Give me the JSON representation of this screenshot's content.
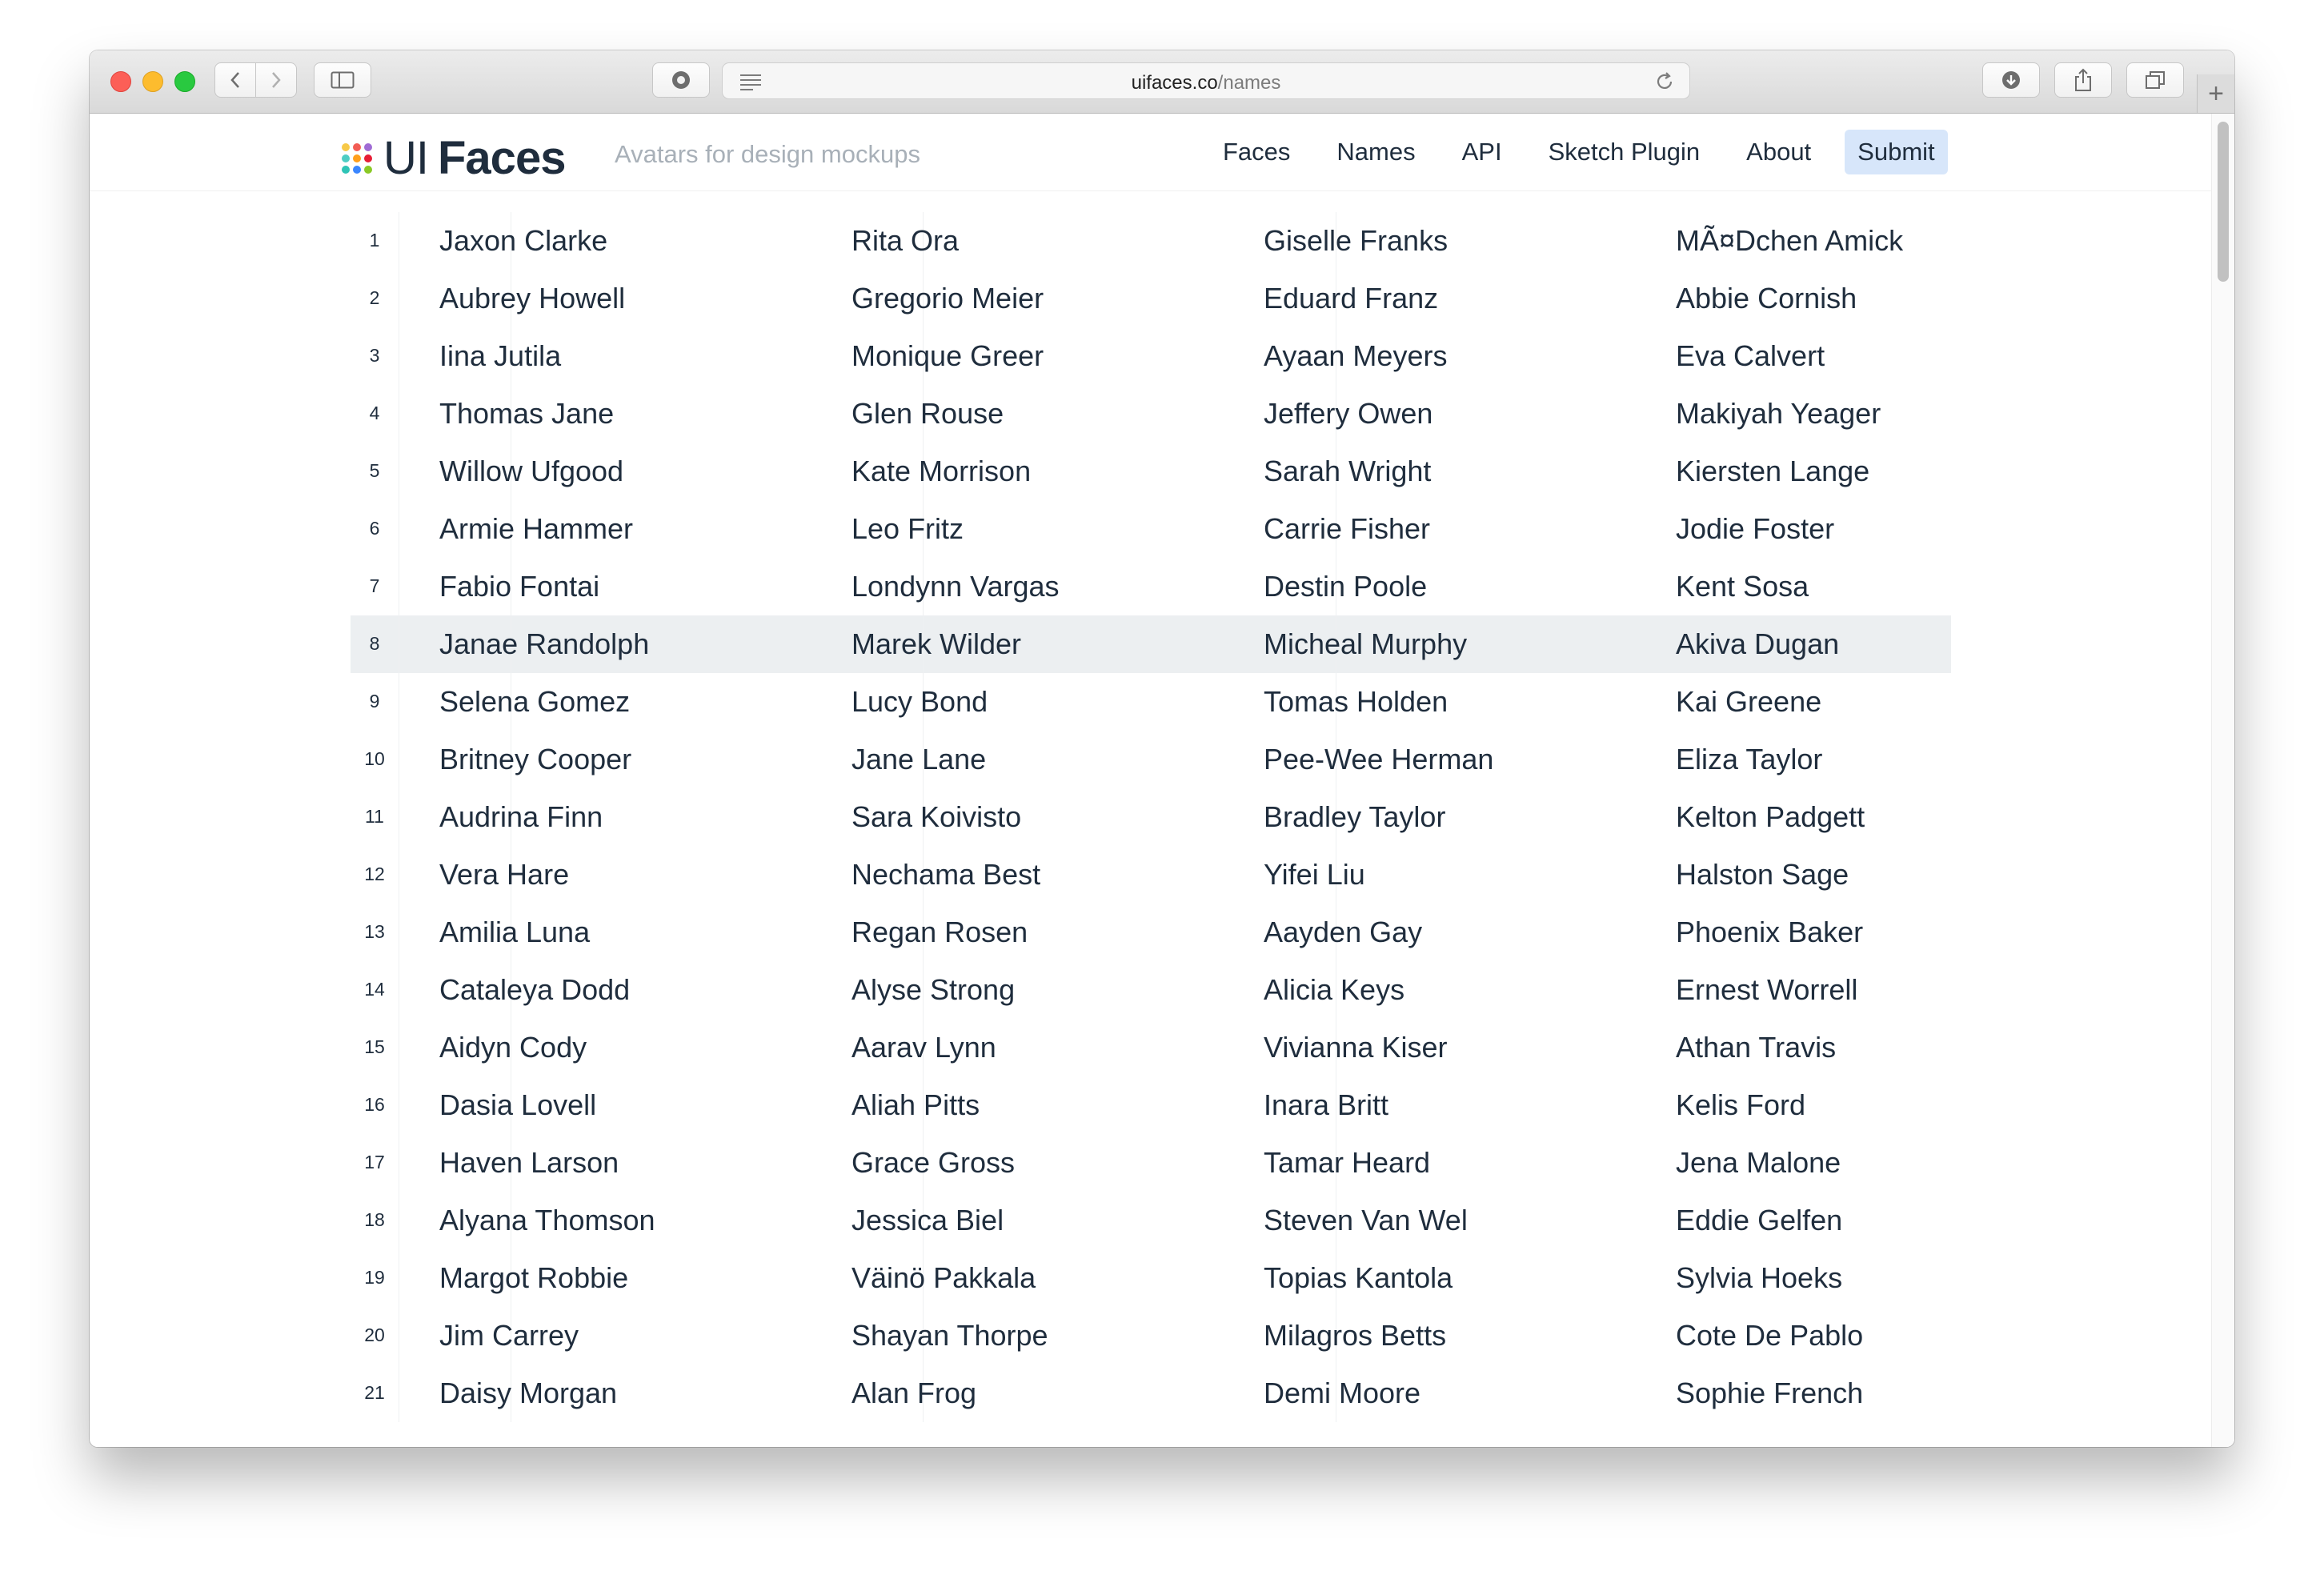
{
  "browser": {
    "url_host": "uifaces.co",
    "url_path": "/names"
  },
  "site": {
    "logo_ui": "UI",
    "logo_faces": "Faces",
    "tagline": "Avatars for design mockups",
    "logo_dot_colors": [
      "#f7c948",
      "#f25c54",
      "#a06cd5",
      "#4ecdc4",
      "#ff9f1c",
      "#e71d36",
      "#2ec4b6",
      "#3a86ff",
      "#8ac926"
    ],
    "nav": [
      {
        "label": "Faces"
      },
      {
        "label": "Names"
      },
      {
        "label": "API"
      },
      {
        "label": "Sketch Plugin"
      },
      {
        "label": "About"
      },
      {
        "label": "Submit",
        "active": true
      }
    ]
  },
  "table": {
    "highlighted_row": 8,
    "rows": [
      {
        "num": "1",
        "names": [
          "Jaxon Clarke",
          "Rita Ora",
          "Giselle Franks",
          "MÃ¤Dchen Amick"
        ]
      },
      {
        "num": "2",
        "names": [
          "Aubrey Howell",
          "Gregorio Meier",
          "Eduard Franz",
          "Abbie Cornish"
        ]
      },
      {
        "num": "3",
        "names": [
          "Iina Jutila",
          "Monique Greer",
          "Ayaan Meyers",
          "Eva Calvert"
        ]
      },
      {
        "num": "4",
        "names": [
          "Thomas Jane",
          "Glen Rouse",
          "Jeffery Owen",
          "Makiyah Yeager"
        ]
      },
      {
        "num": "5",
        "names": [
          "Willow Ufgood",
          "Kate Morrison",
          "Sarah Wright",
          "Kiersten Lange"
        ]
      },
      {
        "num": "6",
        "names": [
          "Armie Hammer",
          "Leo Fritz",
          "Carrie Fisher",
          "Jodie Foster"
        ]
      },
      {
        "num": "7",
        "names": [
          "Fabio Fontai",
          "Londynn Vargas",
          "Destin Poole",
          "Kent Sosa"
        ]
      },
      {
        "num": "8",
        "names": [
          "Janae Randolph",
          "Marek Wilder",
          "Micheal Murphy",
          "Akiva Dugan"
        ]
      },
      {
        "num": "9",
        "names": [
          "Selena Gomez",
          "Lucy Bond",
          "Tomas Holden",
          "Kai Greene"
        ]
      },
      {
        "num": "10",
        "names": [
          "Britney Cooper",
          "Jane Lane",
          "Pee-Wee Herman",
          "Eliza Taylor"
        ]
      },
      {
        "num": "11",
        "names": [
          "Audrina Finn",
          "Sara Koivisto",
          "Bradley Taylor",
          "Kelton Padgett"
        ]
      },
      {
        "num": "12",
        "names": [
          "Vera Hare",
          "Nechama Best",
          "Yifei Liu",
          "Halston Sage"
        ]
      },
      {
        "num": "13",
        "names": [
          "Amilia Luna",
          "Regan Rosen",
          "Aayden Gay",
          "Phoenix Baker"
        ]
      },
      {
        "num": "14",
        "names": [
          "Cataleya Dodd",
          "Alyse Strong",
          "Alicia Keys",
          "Ernest Worrell"
        ]
      },
      {
        "num": "15",
        "names": [
          "Aidyn Cody",
          "Aarav Lynn",
          "Vivianna Kiser",
          "Athan Travis"
        ]
      },
      {
        "num": "16",
        "names": [
          "Dasia Lovell",
          "Aliah Pitts",
          "Inara Britt",
          "Kelis Ford"
        ]
      },
      {
        "num": "17",
        "names": [
          "Haven Larson",
          "Grace Gross",
          "Tamar Heard",
          "Jena Malone"
        ]
      },
      {
        "num": "18",
        "names": [
          "Alyana Thomson",
          "Jessica Biel",
          "Steven Van Wel",
          "Eddie Gelfen"
        ]
      },
      {
        "num": "19",
        "names": [
          "Margot Robbie",
          "Väinö Pakkala",
          "Topias Kantola",
          "Sylvia Hoeks"
        ]
      },
      {
        "num": "20",
        "names": [
          "Jim Carrey",
          "Shayan Thorpe",
          "Milagros Betts",
          "Cote De Pablo"
        ]
      },
      {
        "num": "21",
        "names": [
          "Daisy Morgan",
          "Alan Frog",
          "Demi Moore",
          "Sophie French"
        ]
      }
    ]
  }
}
